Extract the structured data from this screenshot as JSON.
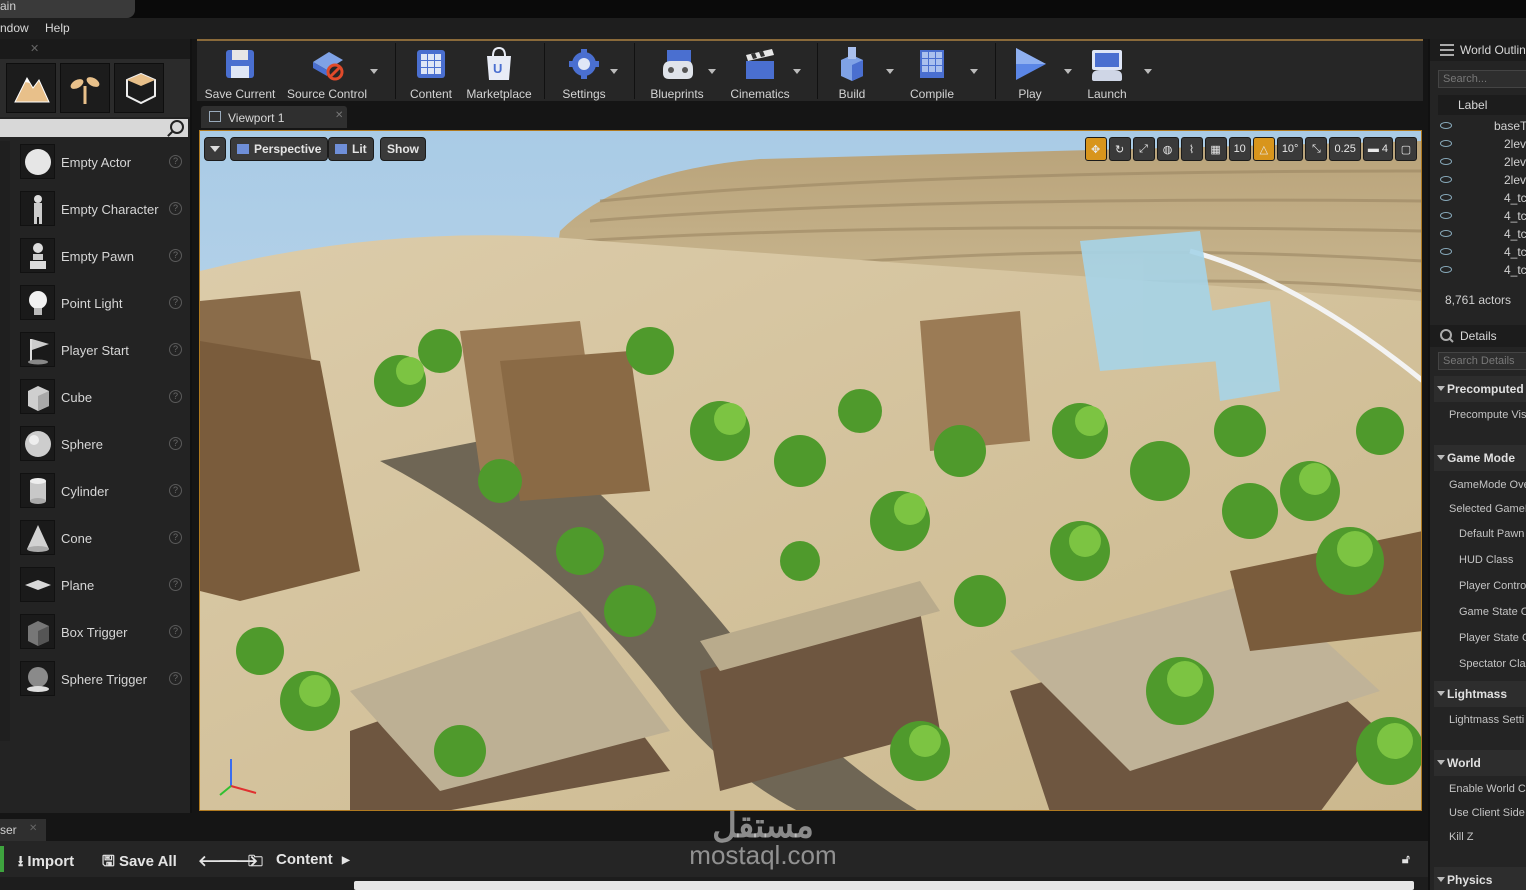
{
  "window": {
    "title_fragment": "ain"
  },
  "menu": {
    "items": [
      "ndow",
      "Help"
    ]
  },
  "toolbar": {
    "buttons": [
      {
        "label": "Save Current",
        "icon": "save-icon"
      },
      {
        "label": "Source Control",
        "icon": "source-control-icon"
      },
      {
        "label": "Content",
        "icon": "content-icon"
      },
      {
        "label": "Marketplace",
        "icon": "marketplace-icon"
      },
      {
        "label": "Settings",
        "icon": "settings-icon"
      },
      {
        "label": "Blueprints",
        "icon": "blueprints-icon"
      },
      {
        "label": "Cinematics",
        "icon": "cinematics-icon"
      },
      {
        "label": "Build",
        "icon": "build-icon"
      },
      {
        "label": "Compile",
        "icon": "compile-icon"
      },
      {
        "label": "Play",
        "icon": "play-icon"
      },
      {
        "label": "Launch",
        "icon": "launch-icon"
      }
    ]
  },
  "place_actors": {
    "items": [
      {
        "label": "Empty Actor"
      },
      {
        "label": "Empty Character"
      },
      {
        "label": "Empty Pawn"
      },
      {
        "label": "Point Light"
      },
      {
        "label": "Player Start"
      },
      {
        "label": "Cube"
      },
      {
        "label": "Sphere"
      },
      {
        "label": "Cylinder"
      },
      {
        "label": "Cone"
      },
      {
        "label": "Plane"
      },
      {
        "label": "Box Trigger"
      },
      {
        "label": "Sphere Trigger"
      }
    ]
  },
  "viewport": {
    "tab_label": "Viewport 1",
    "perspective_label": "Perspective",
    "lit_label": "Lit",
    "show_label": "Show",
    "grid_snap": "10",
    "rotation_snap": "10°",
    "scale_snap": "0.25",
    "camera_speed": "4",
    "accent_color": "#d8951c"
  },
  "world_outliner": {
    "title": "World Outlin",
    "search_placeholder": "Search...",
    "column_label": "Label",
    "rows": [
      "baseT",
      "2lev",
      "2lev",
      "2lev",
      "4_tc",
      "4_tc",
      "4_tc",
      "4_tc",
      "4_tc"
    ],
    "actor_count": "8,761 actors"
  },
  "details": {
    "title": "Details",
    "search_placeholder": "Search Details",
    "categories": {
      "precomputed": "Precomputed",
      "game_mode": "Game Mode",
      "lightmass": "Lightmass",
      "world": "World",
      "physics": "Physics"
    },
    "props": {
      "precompute_vis": "Precompute Vis",
      "gamemode_override": "GameMode Ove",
      "selected_gamemode": "Selected GameM",
      "default_pawn": "Default Pawn",
      "hud_class": "HUD Class",
      "player_controller": "Player Contro",
      "game_state": "Game State C",
      "player_state": "Player State C",
      "spectator_class": "Spectator Cla",
      "lightmass_settings": "Lightmass Setti",
      "enable_world_co": "Enable World Co",
      "use_client_side": "Use Client Side",
      "kill_z": "Kill Z"
    }
  },
  "content_browser": {
    "tab_label": "ser",
    "import_label": "Import",
    "save_all_label": "Save All",
    "path_label": "Content"
  },
  "watermark": {
    "arabic": "مستقل",
    "latin": "mostaql.com"
  }
}
